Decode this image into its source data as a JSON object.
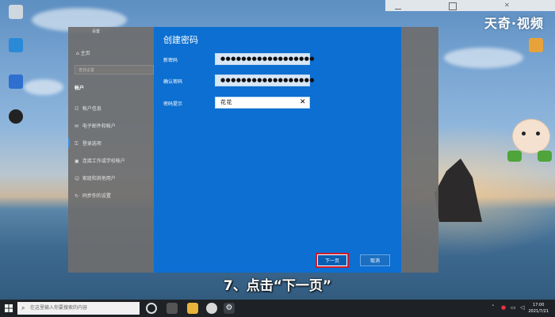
{
  "watermark": "天奇·视频",
  "caption": "7、点击“下一页”",
  "settings": {
    "title": "设置",
    "home": "主页",
    "search_placeholder": "查找设置",
    "section": "帐户",
    "nav": [
      {
        "label": "帐户信息",
        "icon": "user-card-icon"
      },
      {
        "label": "电子邮件和帐户",
        "icon": "mail-icon"
      },
      {
        "label": "登录选项",
        "icon": "key-icon"
      },
      {
        "label": "连接工作或学校帐户",
        "icon": "briefcase-icon"
      },
      {
        "label": "家庭和其他用户",
        "icon": "person-add-icon"
      },
      {
        "label": "同步你的设置",
        "icon": "sync-icon"
      }
    ],
    "active_index": 2
  },
  "dialog": {
    "title": "创建密码",
    "new_password_label": "新密码",
    "new_password_value": "●●●●●●●●●●●●●●●●●●",
    "confirm_password_label": "确认密码",
    "confirm_password_value": "●●●●●●●●●●●●●●●●●●",
    "hint_label": "密码提示",
    "hint_value": "花花",
    "next_button": "下一页",
    "cancel_button": "取消"
  },
  "taskbar": {
    "search_placeholder": "在这里输入你要搜索的内容",
    "time": "17:00",
    "date": "2021/7/21"
  },
  "colors": {
    "dialog_bg": "#0c6fd1",
    "highlight": "#d21a2a",
    "taskbar_bg": "#1e2226"
  }
}
